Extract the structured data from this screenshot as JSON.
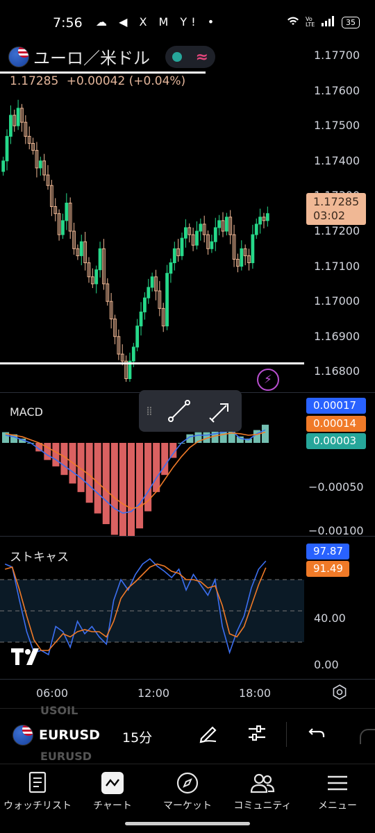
{
  "status_bar": {
    "time": "7:56",
    "icons": "☁ ◀ X M Y! •",
    "battery": "35",
    "network": "Vo LTE"
  },
  "header": {
    "title": "ユーロ／米ドル",
    "price": "1.17285",
    "change": "+0.00042",
    "change_pct": "(+0.04%)"
  },
  "price_axis": [
    "1.17700",
    "1.17600",
    "1.17500",
    "1.17400",
    "1.17300",
    "1.17200",
    "1.17100",
    "1.17000",
    "1.16900",
    "1.16800"
  ],
  "price_label": {
    "price": "1.17285",
    "countdown": "03:02"
  },
  "macd": {
    "title": "MACD",
    "values": [
      "0.00017",
      "0.00014",
      "0.00003"
    ],
    "axis": [
      "−0.00050",
      "−0.00100"
    ]
  },
  "stochastic": {
    "title": "ストキャス",
    "values": [
      "97.87",
      "91.49"
    ],
    "axis": [
      "40.00",
      "0.00"
    ]
  },
  "time_axis": [
    "06:00",
    "12:00",
    "18:00"
  ],
  "symbol_bar": {
    "ghost_top": "USOIL",
    "symbol": "EURUSD",
    "ghost_bottom": "EURUSD",
    "interval": "15分"
  },
  "nav": {
    "items": [
      {
        "label": "ウォッチリスト"
      },
      {
        "label": "チャート"
      },
      {
        "label": "マーケット"
      },
      {
        "label": "コミュニティ"
      },
      {
        "label": "メニュー"
      }
    ]
  },
  "colors": {
    "up": "#26d98a",
    "down": "#f0b895",
    "macd_line": "#3c6ff0",
    "signal_line": "#f07a28",
    "hist_pos": "#7fd4c4",
    "hist_neg": "#f26b6b",
    "stoch_k": "#3c6ff0",
    "stoch_d": "#f07a28"
  },
  "chart_data": [
    {
      "type": "candlestick",
      "title": "ユーロ／米ドル",
      "interval": "15分",
      "ylim": [
        1.1675,
        1.1775
      ],
      "close_series": [
        1.1745,
        1.1752,
        1.1758,
        1.1755,
        1.176,
        1.1756,
        1.1752,
        1.175,
        1.1748,
        1.1743,
        1.1745,
        1.1741,
        1.1738,
        1.1732,
        1.173,
        1.1724,
        1.1728,
        1.1733,
        1.1725,
        1.172,
        1.1718,
        1.1722,
        1.1716,
        1.1712,
        1.171,
        1.1714,
        1.172,
        1.171,
        1.1705,
        1.17,
        1.1695,
        1.169,
        1.1688,
        1.1683,
        1.1688,
        1.1692,
        1.1698,
        1.1702,
        1.1706,
        1.1709,
        1.1712,
        1.1708,
        1.1703,
        1.1698,
        1.1713,
        1.1716,
        1.172,
        1.1718,
        1.1723,
        1.1726,
        1.1724,
        1.1721,
        1.1725,
        1.1727,
        1.1724,
        1.172,
        1.1722,
        1.1726,
        1.1728,
        1.1725,
        1.1729,
        1.1724,
        1.1717,
        1.1715,
        1.172,
        1.1718,
        1.1716,
        1.1724,
        1.1727,
        1.1729,
        1.1728,
        1.173
      ]
    },
    {
      "type": "line",
      "title": "MACD",
      "series": [
        {
          "values": [
            0.0001,
            8e-05,
            4e-05,
            0.0,
            -8e-05,
            -0.00016,
            -0.00022,
            -0.0003,
            -0.00038,
            -0.00046,
            -0.00056,
            -0.00066,
            -0.00076,
            -0.00086,
            -0.00092,
            -0.0009,
            -0.0008,
            -0.00064,
            -0.00046,
            -0.0003,
            -0.00014,
            0.0,
            8e-05,
            0.0001,
            0.0001,
            0.00012,
            0.00014,
            0.00016,
            6e-05,
            4e-05,
            0.00012,
            0.00017
          ]
        },
        {
          "values": [
            0.00012,
            0.0001,
            8e-05,
            4e-05,
            0.0,
            -6e-05,
            -0.00012,
            -0.00018,
            -0.00026,
            -0.00034,
            -0.00042,
            -0.00052,
            -0.00062,
            -0.00072,
            -0.0008,
            -0.00086,
            -0.00084,
            -0.00076,
            -0.00064,
            -0.00048,
            -0.00032,
            -0.00018,
            -6e-05,
            2e-05,
            6e-05,
            9e-05,
            0.00011,
            0.00013,
            0.00012,
            0.0001,
            0.00011,
            0.00014
          ]
        }
      ]
    },
    {
      "type": "line",
      "title": "ストキャス",
      "ylim": [
        0,
        100
      ],
      "series": [
        {
          "values": [
            95,
            92,
            60,
            30,
            10,
            12,
            8,
            35,
            30,
            15,
            40,
            28,
            35,
            25,
            18,
            60,
            80,
            70,
            85,
            95,
            100,
            93,
            88,
            82,
            90,
            70,
            85,
            75,
            65,
            80,
            35,
            10,
            30,
            45,
            72,
            90,
            97.87
          ]
        },
        {
          "values": [
            90,
            92,
            70,
            45,
            22,
            12,
            12,
            20,
            28,
            25,
            30,
            32,
            30,
            30,
            25,
            40,
            62,
            72,
            78,
            85,
            92,
            95,
            93,
            88,
            86,
            80,
            80,
            78,
            72,
            74,
            55,
            28,
            25,
            35,
            55,
            75,
            91.49
          ]
        }
      ]
    }
  ]
}
